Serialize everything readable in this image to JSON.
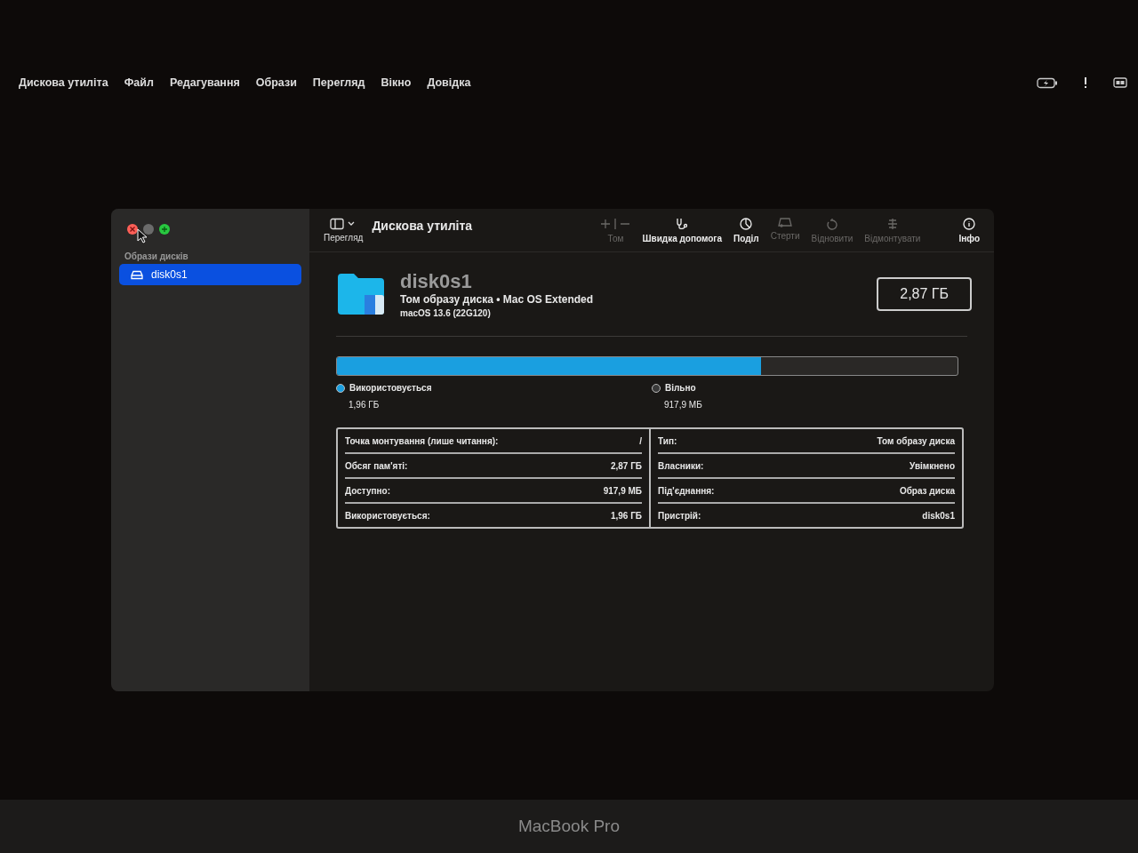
{
  "menu_bar": {
    "app_name": "Дискова утиліта",
    "items": [
      "Файл",
      "Редагування",
      "Образи",
      "Перегляд",
      "Вікно",
      "Довідка"
    ]
  },
  "window": {
    "title": "Дискова утиліта"
  },
  "sidebar": {
    "section": "Образи дисків",
    "items": [
      {
        "label": "disk0s1",
        "selected": true
      }
    ]
  },
  "toolbar": {
    "view_label": "Перегляд",
    "items": [
      {
        "kind": "volume",
        "label": "Том",
        "disabled": true
      },
      {
        "kind": "first-aid",
        "label": "Швидка допомога",
        "disabled": false
      },
      {
        "kind": "partition",
        "label": "Поділ",
        "disabled": false
      },
      {
        "kind": "erase",
        "label": "Стерти",
        "disabled": true
      },
      {
        "kind": "restore",
        "label": "Відновити",
        "disabled": true
      },
      {
        "kind": "unmount",
        "label": "Відмонтувати",
        "disabled": true
      },
      {
        "kind": "info",
        "label": "Інфо",
        "disabled": false
      }
    ]
  },
  "volume": {
    "name": "disk0s1",
    "subtitle": "Том образу диска • Mac OS Extended",
    "os": "macOS 13.6 (22G120)",
    "capacity": "2,87 ГБ"
  },
  "usage": {
    "level": 0.684,
    "legend": [
      {
        "label": "Використовується",
        "value": "1,96 ГБ",
        "color": "#1a9fe0"
      },
      {
        "label": "Вільно",
        "value": "917,9 МБ",
        "color": "#3a3a3a"
      }
    ]
  },
  "details": {
    "columns": [
      [
        {
          "label": "Точка монтування (лише читання):",
          "value": "/"
        },
        {
          "label": "Обсяг пам'яті:",
          "value": "2,87 ГБ"
        },
        {
          "label": "Доступно:",
          "value": "917,9 МБ"
        },
        {
          "label": "Використовується:",
          "value": "1,96 ГБ"
        }
      ],
      [
        {
          "label": "Тип:",
          "value": "Том образу диска"
        },
        {
          "label": "Власники:",
          "value": "Увімкнено"
        },
        {
          "label": "Під'єднання:",
          "value": "Образ диска"
        },
        {
          "label": "Пристрій:",
          "value": "disk0s1"
        }
      ]
    ]
  },
  "bezel": {
    "label": "MacBook Pro"
  }
}
